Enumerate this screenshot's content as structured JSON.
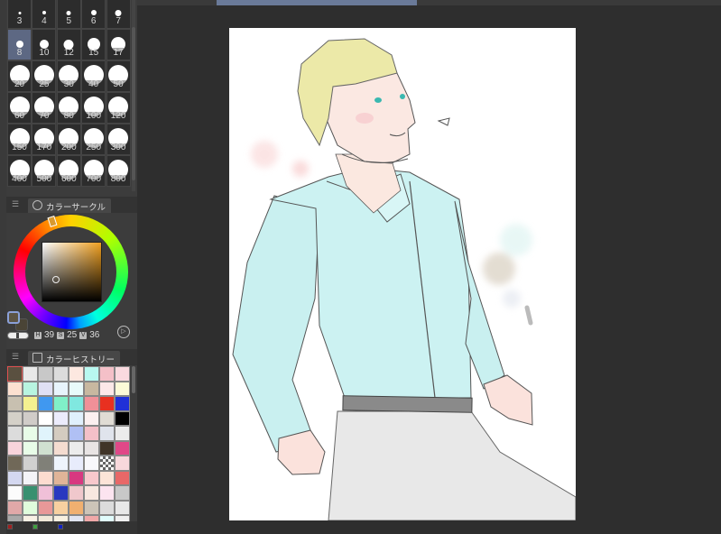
{
  "brush_sizes": {
    "items": [
      "3",
      "4",
      "5",
      "6",
      "7",
      "8",
      "10",
      "12",
      "15",
      "17",
      "20",
      "25",
      "30",
      "40",
      "50",
      "60",
      "70",
      "80",
      "100",
      "120",
      "150",
      "170",
      "200",
      "250",
      "300",
      "400",
      "500",
      "600",
      "700",
      "800"
    ],
    "selected": "8"
  },
  "color_circle": {
    "tab_label": "カラーサークル",
    "h_key": "H",
    "h": "39",
    "s_key": "S",
    "s": "25",
    "v_key": "V",
    "v": "36",
    "fg_color": "#5c5444"
  },
  "color_history": {
    "tab_label": "カラーヒストリー",
    "swatches": [
      "#5a5040",
      "#e8e8e8",
      "#c8c8c8",
      "#dcdcdc",
      "#fde8e0",
      "#b8f8f0",
      "#f4c0c8",
      "#fadadf",
      "#fce0d0",
      "#b8f4e0",
      "#e0e0f4",
      "#e8f4fc",
      "#e8fafa",
      "#c8b8a0",
      "#fce8e8",
      "#fcfad8",
      "#c8c0b0",
      "#f4f090",
      "#4098f0",
      "#80f0c8",
      "#80e8e0",
      "#f09098",
      "#e83020",
      "#2030d8",
      "#d4d0c8",
      "#d0ccc8",
      "#ffffff",
      "#ececfc",
      "#e0f0fc",
      "#fcf0f0",
      "#e0dcd4",
      "#000000",
      "#dcdcdc",
      "#e8fce8",
      "#e0f4fc",
      "#d4ccc0",
      "#b0c0f4",
      "#f4c0c8",
      "#e0e4ec",
      "#ececec",
      "#f8d4dc",
      "#e8fce8",
      "#d0e0d0",
      "#f4dcd0",
      "#ececec",
      "#e8e4e4",
      "#403428",
      "#e04888",
      "#706858",
      "#d0d0d0",
      "#808078",
      "#eef4fc",
      "#e8ecfc",
      "#f8f8fc",
      "transparent",
      "#f8d8dc",
      "#d4d8f0",
      "#f4f4f8",
      "#fcdcd0",
      "#e0b498",
      "#d83880",
      "#f8c8cc",
      "#fce4d8",
      "#e86868",
      "#fcfcfc",
      "#389070",
      "#f0c0d8",
      "#2838c0",
      "#f0c8cc",
      "#f8e8e0",
      "#fce4f0",
      "#c8c8c8",
      "#e0a8a8",
      "#e0fcdc",
      "#e89898",
      "#f8d0a0",
      "#f0b070",
      "#ccc4b8",
      "#dcdcdc",
      "#e8e8e8",
      "#a8a8a8",
      "#f8f0e4",
      "#f0e8d8",
      "#f8f0e0",
      "#e0e4f0",
      "#f0a8a8",
      "#e0fcfc",
      "#f0f0f0"
    ]
  },
  "bottom_colors": [
    "#a02020",
    "#40a040",
    "#1020c0"
  ],
  "colors": {
    "shirt": "#c9f0f0",
    "hair": "#ece9a8",
    "skin": "#fbe6de",
    "line": "#555048",
    "pants": "#e6e6e6",
    "belt": "#8a8a8a"
  }
}
